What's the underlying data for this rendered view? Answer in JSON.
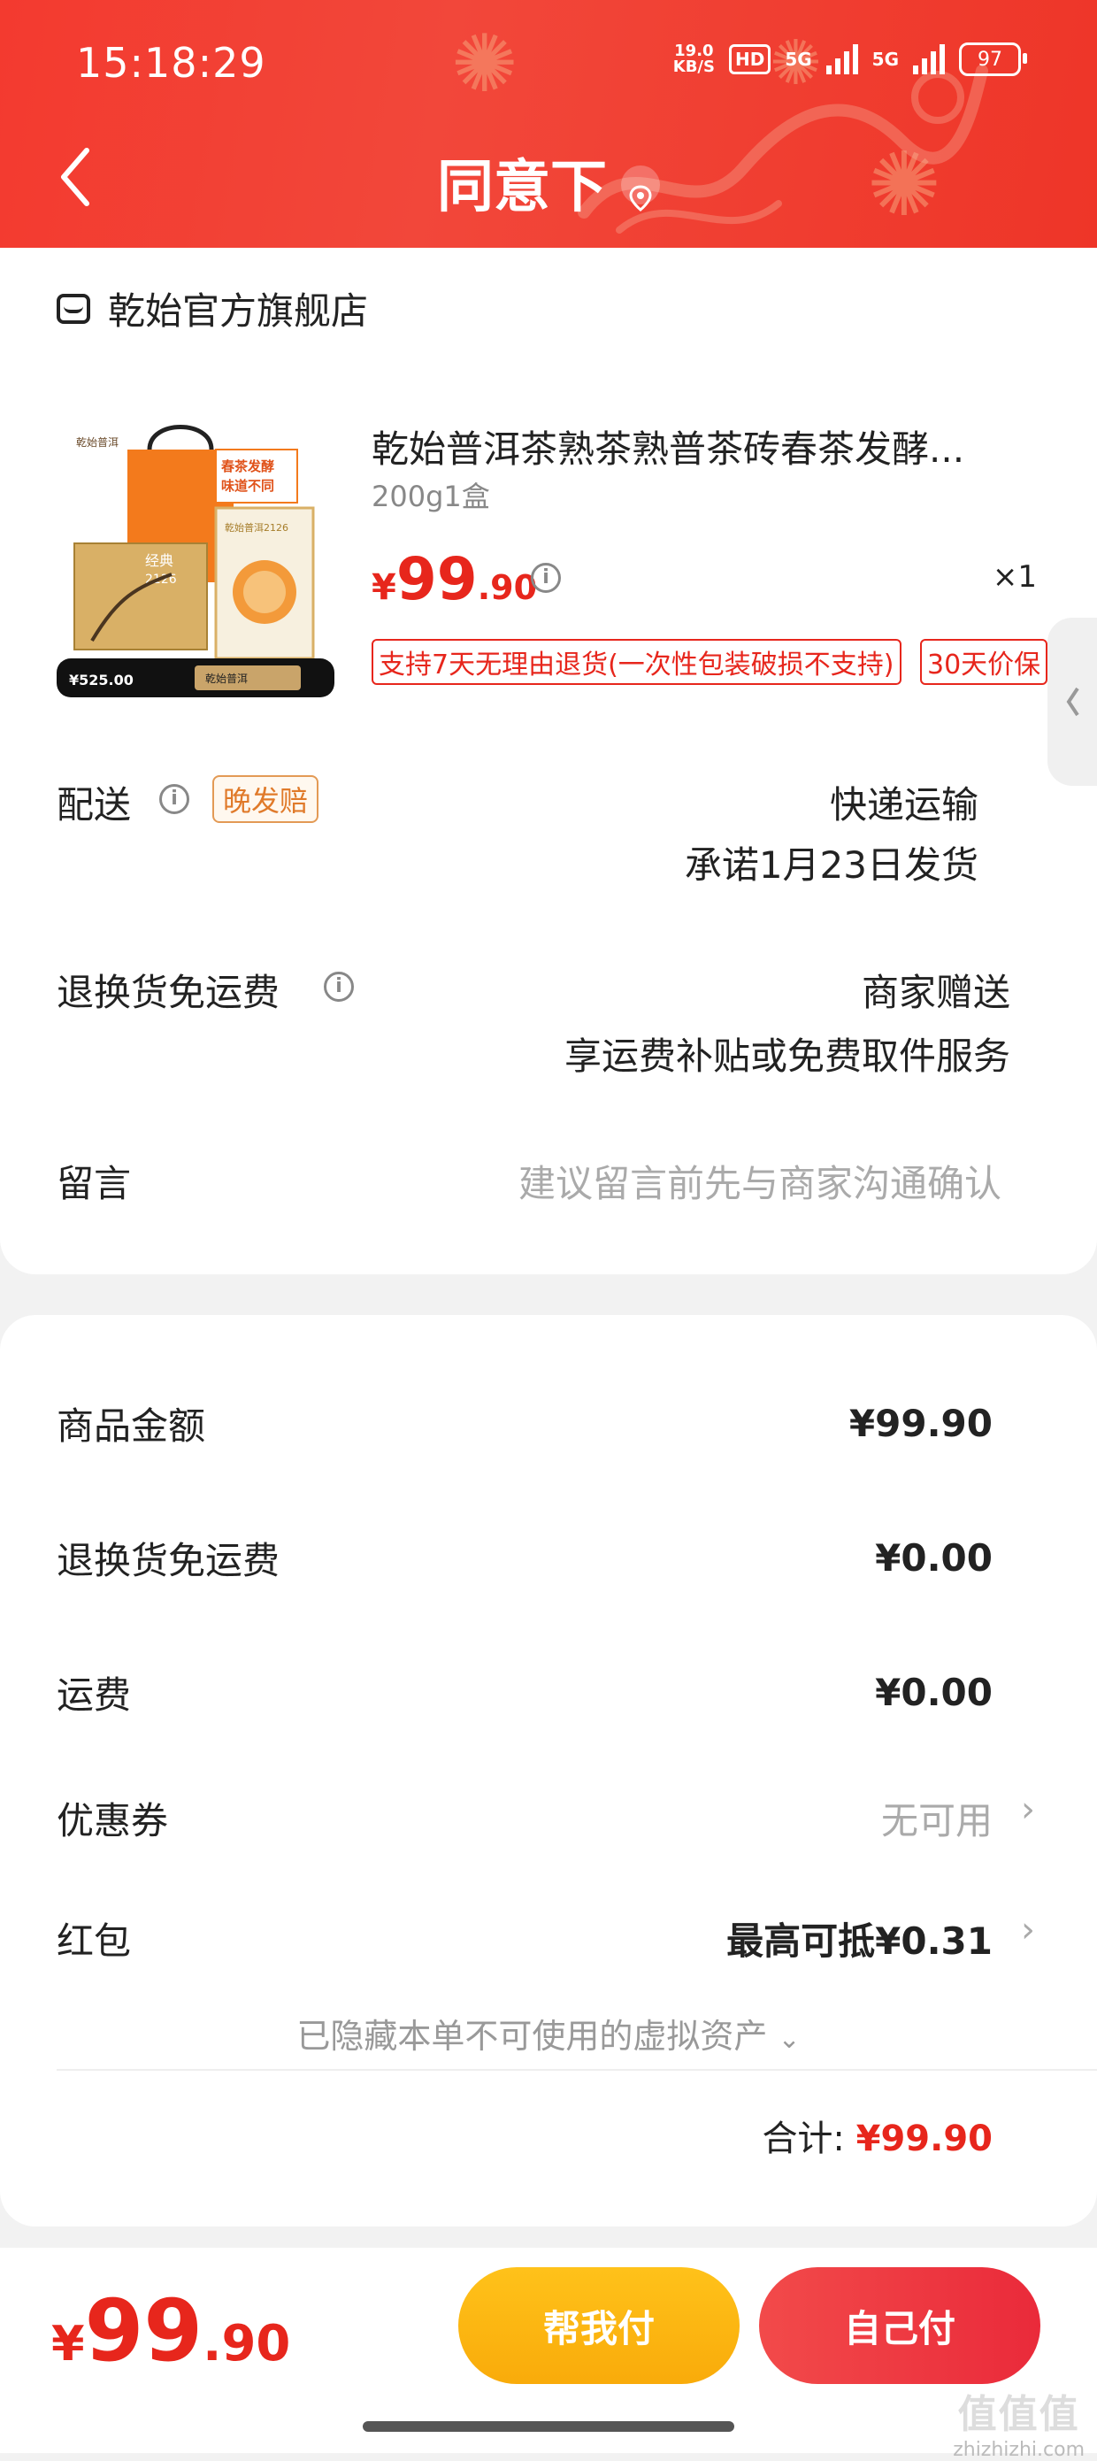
{
  "status_bar": {
    "time": "15:18:29",
    "speed_value": "19.0",
    "speed_unit": "KB/S",
    "hd": "HD",
    "net1": "5G",
    "net2": "5G",
    "battery": "97"
  },
  "header": {
    "title": "同意下",
    "back_icon": "chevron-left-icon",
    "location_icon": "location-pin-icon"
  },
  "store": {
    "name": "乾始官方旗舰店"
  },
  "product": {
    "name": "乾始普洱茶熟茶熟普茶砖春茶发酵...",
    "spec": "200g1盒",
    "price_currency": "¥",
    "price_int": "99",
    "price_dec": ".90",
    "quantity": "×1",
    "image_text": {
      "brand": "乾始普洱",
      "slogan_line1": "春茶发酵",
      "slogan_line2": "味道不同",
      "box_line1": "经典",
      "box_line2": "2126",
      "tin_label": "乾始普洱2126",
      "price_badge": "¥525.00",
      "bottom_banner": "乾始普洱"
    },
    "tags": [
      "支持7天无理由退货(一次性包装破损不支持)",
      "30天价保"
    ]
  },
  "delivery": {
    "label": "配送",
    "late_tag": "晚发赔",
    "method": "快递运输",
    "promise": "承诺1月23日发货"
  },
  "return_shipping": {
    "label": "退换货免运费",
    "line1": "商家赠送",
    "line2": "享运费补贴或免费取件服务"
  },
  "message": {
    "label": "留言",
    "placeholder": "建议留言前先与商家沟通确认"
  },
  "summary": {
    "goods_label": "商品金额",
    "goods_value": "¥99.90",
    "return_label": "退换货免运费",
    "return_value": "¥0.00",
    "freight_label": "运费",
    "freight_value": "¥0.00",
    "coupon_label": "优惠券",
    "coupon_value": "无可用",
    "redpacket_label": "红包",
    "redpacket_value": "最高可抵¥0.31",
    "hidden_assets": "已隐藏本单不可使用的虚拟资产",
    "total_label": "合计:",
    "total_value": "¥99.90"
  },
  "bottom": {
    "price_currency": "¥",
    "price_int": "99",
    "price_dec": ".90",
    "help_pay": "帮我付",
    "self_pay": "自己付"
  },
  "watermark": {
    "text": "值值值",
    "url": "zhizhizhi.com"
  }
}
